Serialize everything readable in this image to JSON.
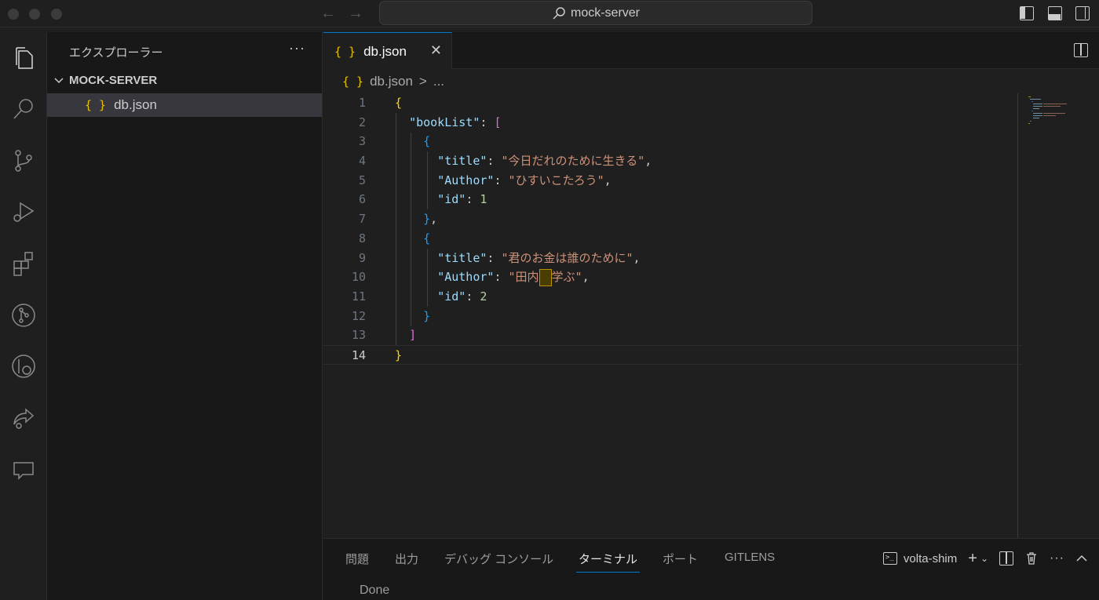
{
  "window": {
    "search_text": "mock-server"
  },
  "sidebar": {
    "title": "エクスプローラー",
    "more": "···",
    "folder": "MOCK-SERVER",
    "files": [
      {
        "icon": "{ }",
        "name": "db.json"
      }
    ]
  },
  "editor": {
    "tab": {
      "icon": "{ }",
      "label": "db.json",
      "close": "✕"
    },
    "breadcrumb": {
      "icon": "{ }",
      "file": "db.json",
      "sep": ">",
      "rest": "..."
    },
    "line_numbers": [
      "1",
      "2",
      "3",
      "4",
      "5",
      "6",
      "7",
      "8",
      "9",
      "10",
      "11",
      "12",
      "13",
      "14"
    ],
    "current_line": 14,
    "code": {
      "book_list_key": "\"bookList\"",
      "title_key": "\"title\"",
      "author_key": "\"Author\"",
      "id_key": "\"id\"",
      "book1_title": "\"今日だれのために生きる\"",
      "book1_author": "\"ひすいこたろう\"",
      "book1_id": "1",
      "book2_title": "\"君のお金は誰のために\"",
      "book2_author_a": "\"田内",
      "book2_author_b": "学ぶ\"",
      "book2_id": "2"
    }
  },
  "panel": {
    "tabs": [
      "問題",
      "出力",
      "デバッグ コンソール",
      "ターミナル",
      "ポート",
      "GITLENS"
    ],
    "active_tab": "ターミナル",
    "terminal_name": "volta-shim",
    "output": "Done"
  },
  "colors": {
    "accent": "#0078d4",
    "json_icon": "#e8c000"
  }
}
